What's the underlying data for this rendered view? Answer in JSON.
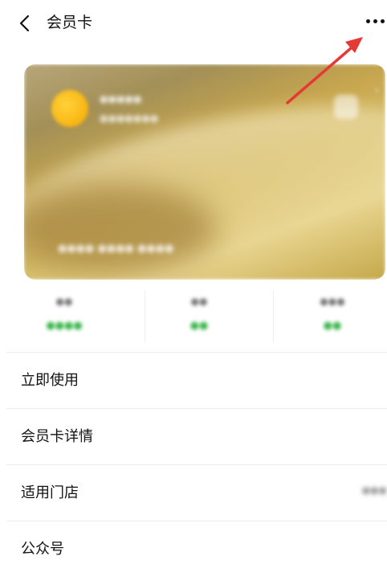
{
  "header": {
    "title": "会员卡",
    "back_icon": "chevron-left-icon",
    "more_icon": "more-dots-icon"
  },
  "card": {
    "name": "●●●●●",
    "subtitle": "●●●●●●●",
    "number": "●●●● ●●●● ●●●●",
    "logo_color": "#f5a800",
    "base_color": "#c7a64e"
  },
  "stats": [
    {
      "label": "●●",
      "value": "●●●●"
    },
    {
      "label": "●●",
      "value": "●●"
    },
    {
      "label": "●●●",
      "value": "●●"
    }
  ],
  "menu": {
    "items": [
      {
        "label": "立即使用",
        "extra": ""
      },
      {
        "label": "会员卡详情",
        "extra": ""
      },
      {
        "label": "适用门店",
        "extra": "●●●"
      },
      {
        "label": "公众号",
        "extra": ""
      }
    ]
  },
  "colors": {
    "accent_green": "#39b54a",
    "annotation_red": "#e53935"
  }
}
